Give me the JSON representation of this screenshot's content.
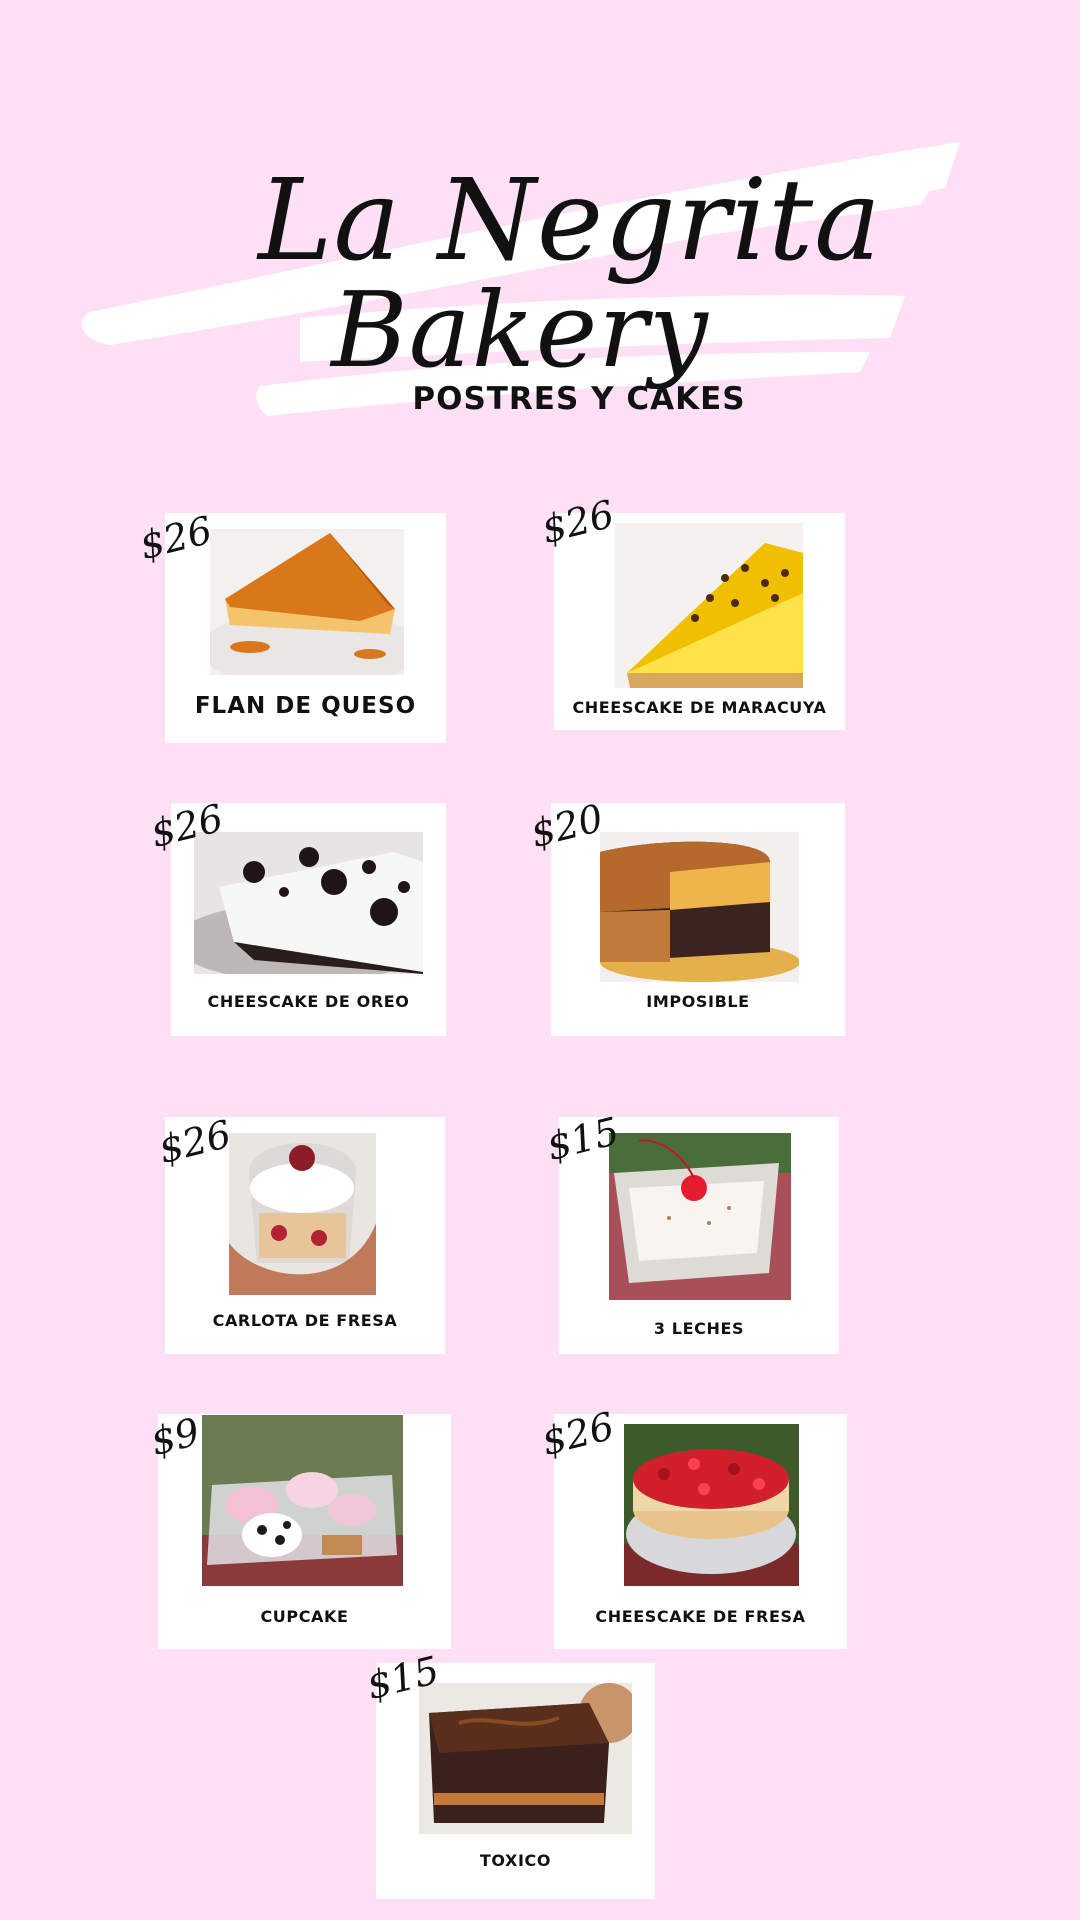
{
  "header": {
    "title_line1": "La Negrita",
    "title_line2": "Bakery",
    "subtitle": "POSTRES Y CAKES"
  },
  "colors": {
    "background": "#fde0f5",
    "card": "#ffffff",
    "text": "#111111"
  },
  "products": [
    {
      "name": "FLAN DE QUESO",
      "price": "$26",
      "image": "flan-photo"
    },
    {
      "name": "CHEESCAKE DE MARACUYA",
      "price": "$26",
      "image": "passionfruit-cheesecake-photo"
    },
    {
      "name": "CHEESCAKE DE OREO",
      "price": "$26",
      "image": "oreo-cheesecake-photo"
    },
    {
      "name": "IMPOSIBLE",
      "price": "$20",
      "image": "chocoflan-photo"
    },
    {
      "name": "CARLOTA DE FRESA",
      "price": "$26",
      "image": "strawberry-carlota-photo"
    },
    {
      "name": "3 LECHES",
      "price": "$15",
      "image": "tres-leches-photo"
    },
    {
      "name": "CUPCAKE",
      "price": "$9",
      "image": "cupcakes-photo"
    },
    {
      "name": "CHEESCAKE DE FRESA",
      "price": "$26",
      "image": "strawberry-cheesecake-photo"
    },
    {
      "name": "TOXICO",
      "price": "$15",
      "image": "brownie-photo"
    }
  ]
}
